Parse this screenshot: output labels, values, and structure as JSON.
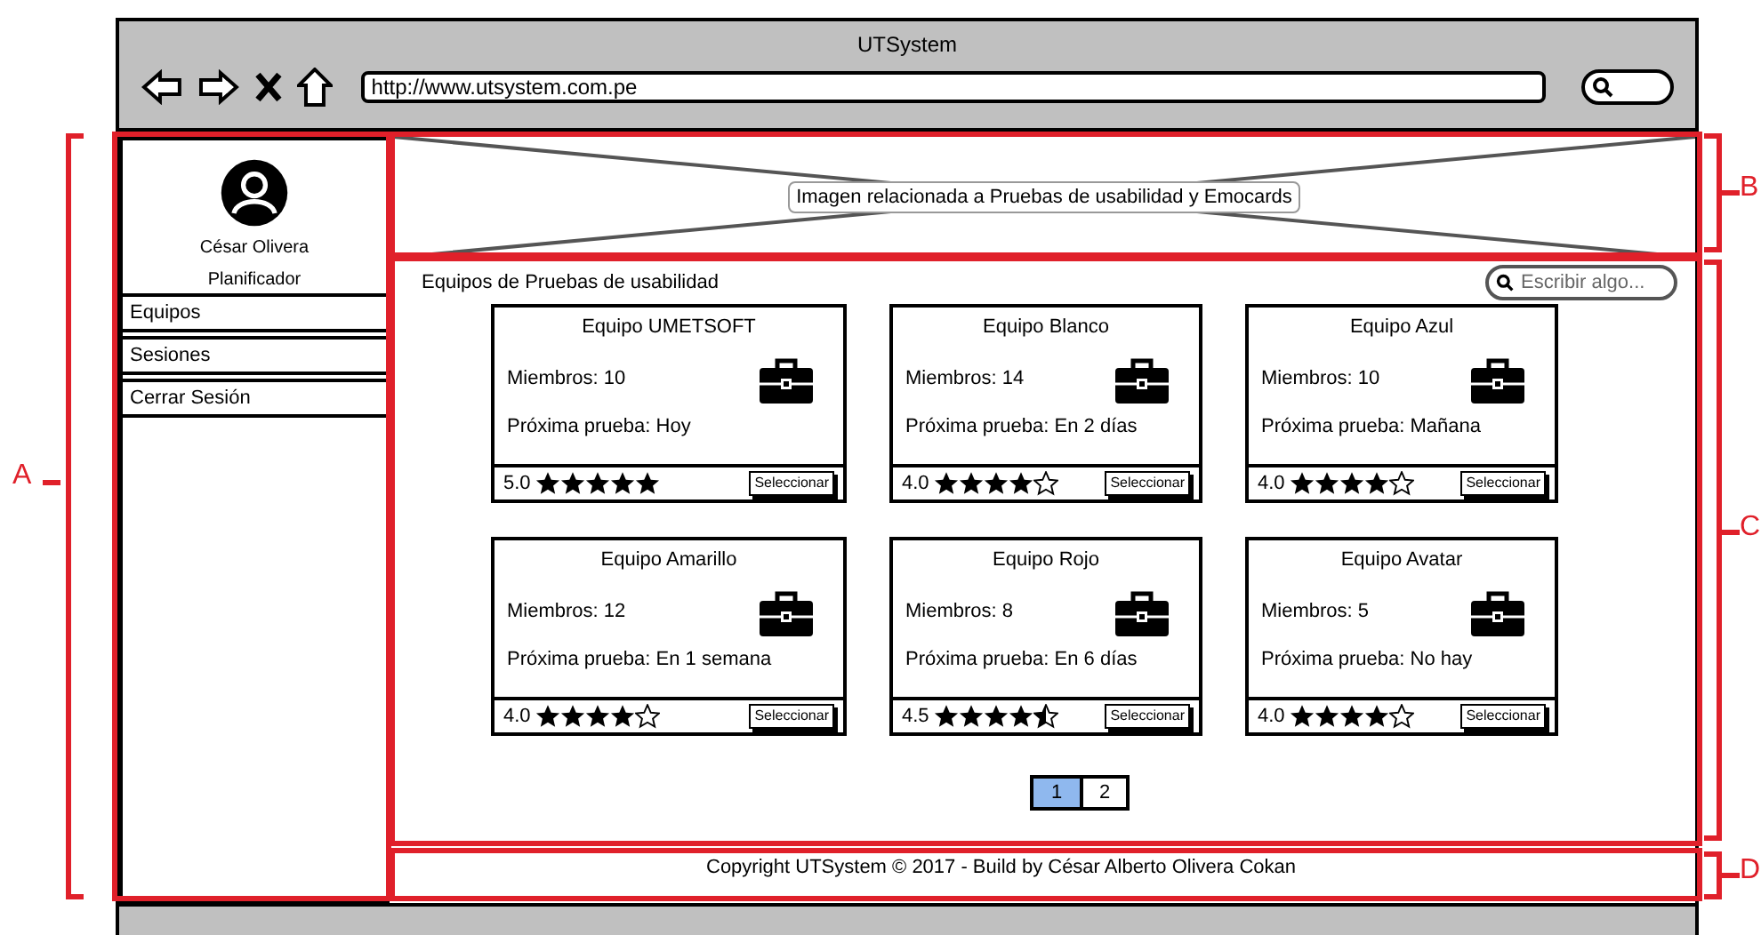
{
  "browser": {
    "title": "UTSystem",
    "url": "http://www.utsystem.com.pe"
  },
  "sidebar": {
    "user_name": "César Olivera",
    "role": "Planificador",
    "items": [
      {
        "label": "Equipos"
      },
      {
        "label": "Sesiones"
      },
      {
        "label": "Cerrar Sesión"
      }
    ]
  },
  "banner": {
    "caption": "Imagen relacionada a Pruebas de usabilidad y Emocards"
  },
  "content": {
    "heading": "Equipos de Pruebas de usabilidad",
    "search": {
      "placeholder": "Escribir algo..."
    },
    "teams": [
      {
        "name": "Equipo UMETSOFT",
        "members": "Miembros: 10",
        "next_test": "Próxima prueba: Hoy",
        "rating": "5.0",
        "stars": 5,
        "button": "Seleccionar"
      },
      {
        "name": "Equipo Blanco",
        "members": "Miembros: 14",
        "next_test": "Próxima prueba: En 2 días",
        "rating": "4.0",
        "stars": 4,
        "button": "Seleccionar"
      },
      {
        "name": "Equipo Azul",
        "members": "Miembros: 10",
        "next_test": "Próxima prueba: Mañana",
        "rating": "4.0",
        "stars": 4,
        "button": "Seleccionar"
      },
      {
        "name": "Equipo Amarillo",
        "members": "Miembros: 12",
        "next_test": "Próxima prueba: En 1 semana",
        "rating": "4.0",
        "stars": 4,
        "button": "Seleccionar"
      },
      {
        "name": "Equipo Rojo",
        "members": "Miembros: 8",
        "next_test": "Próxima prueba: En 6 días",
        "rating": "4.5",
        "stars": 4.5,
        "button": "Seleccionar"
      },
      {
        "name": "Equipo Avatar",
        "members": "Miembros: 5",
        "next_test": "Próxima prueba: No hay",
        "rating": "4.0",
        "stars": 4,
        "button": "Seleccionar"
      }
    ],
    "pagination": [
      {
        "label": "1",
        "selected": true
      },
      {
        "label": "2",
        "selected": false
      }
    ]
  },
  "footer": {
    "text": "Copyright UTSystem © 2017 - Build by César Alberto Olivera Cokan"
  },
  "annotations": [
    {
      "label": "A"
    },
    {
      "label": "B"
    },
    {
      "label": "C"
    },
    {
      "label": "D"
    }
  ]
}
